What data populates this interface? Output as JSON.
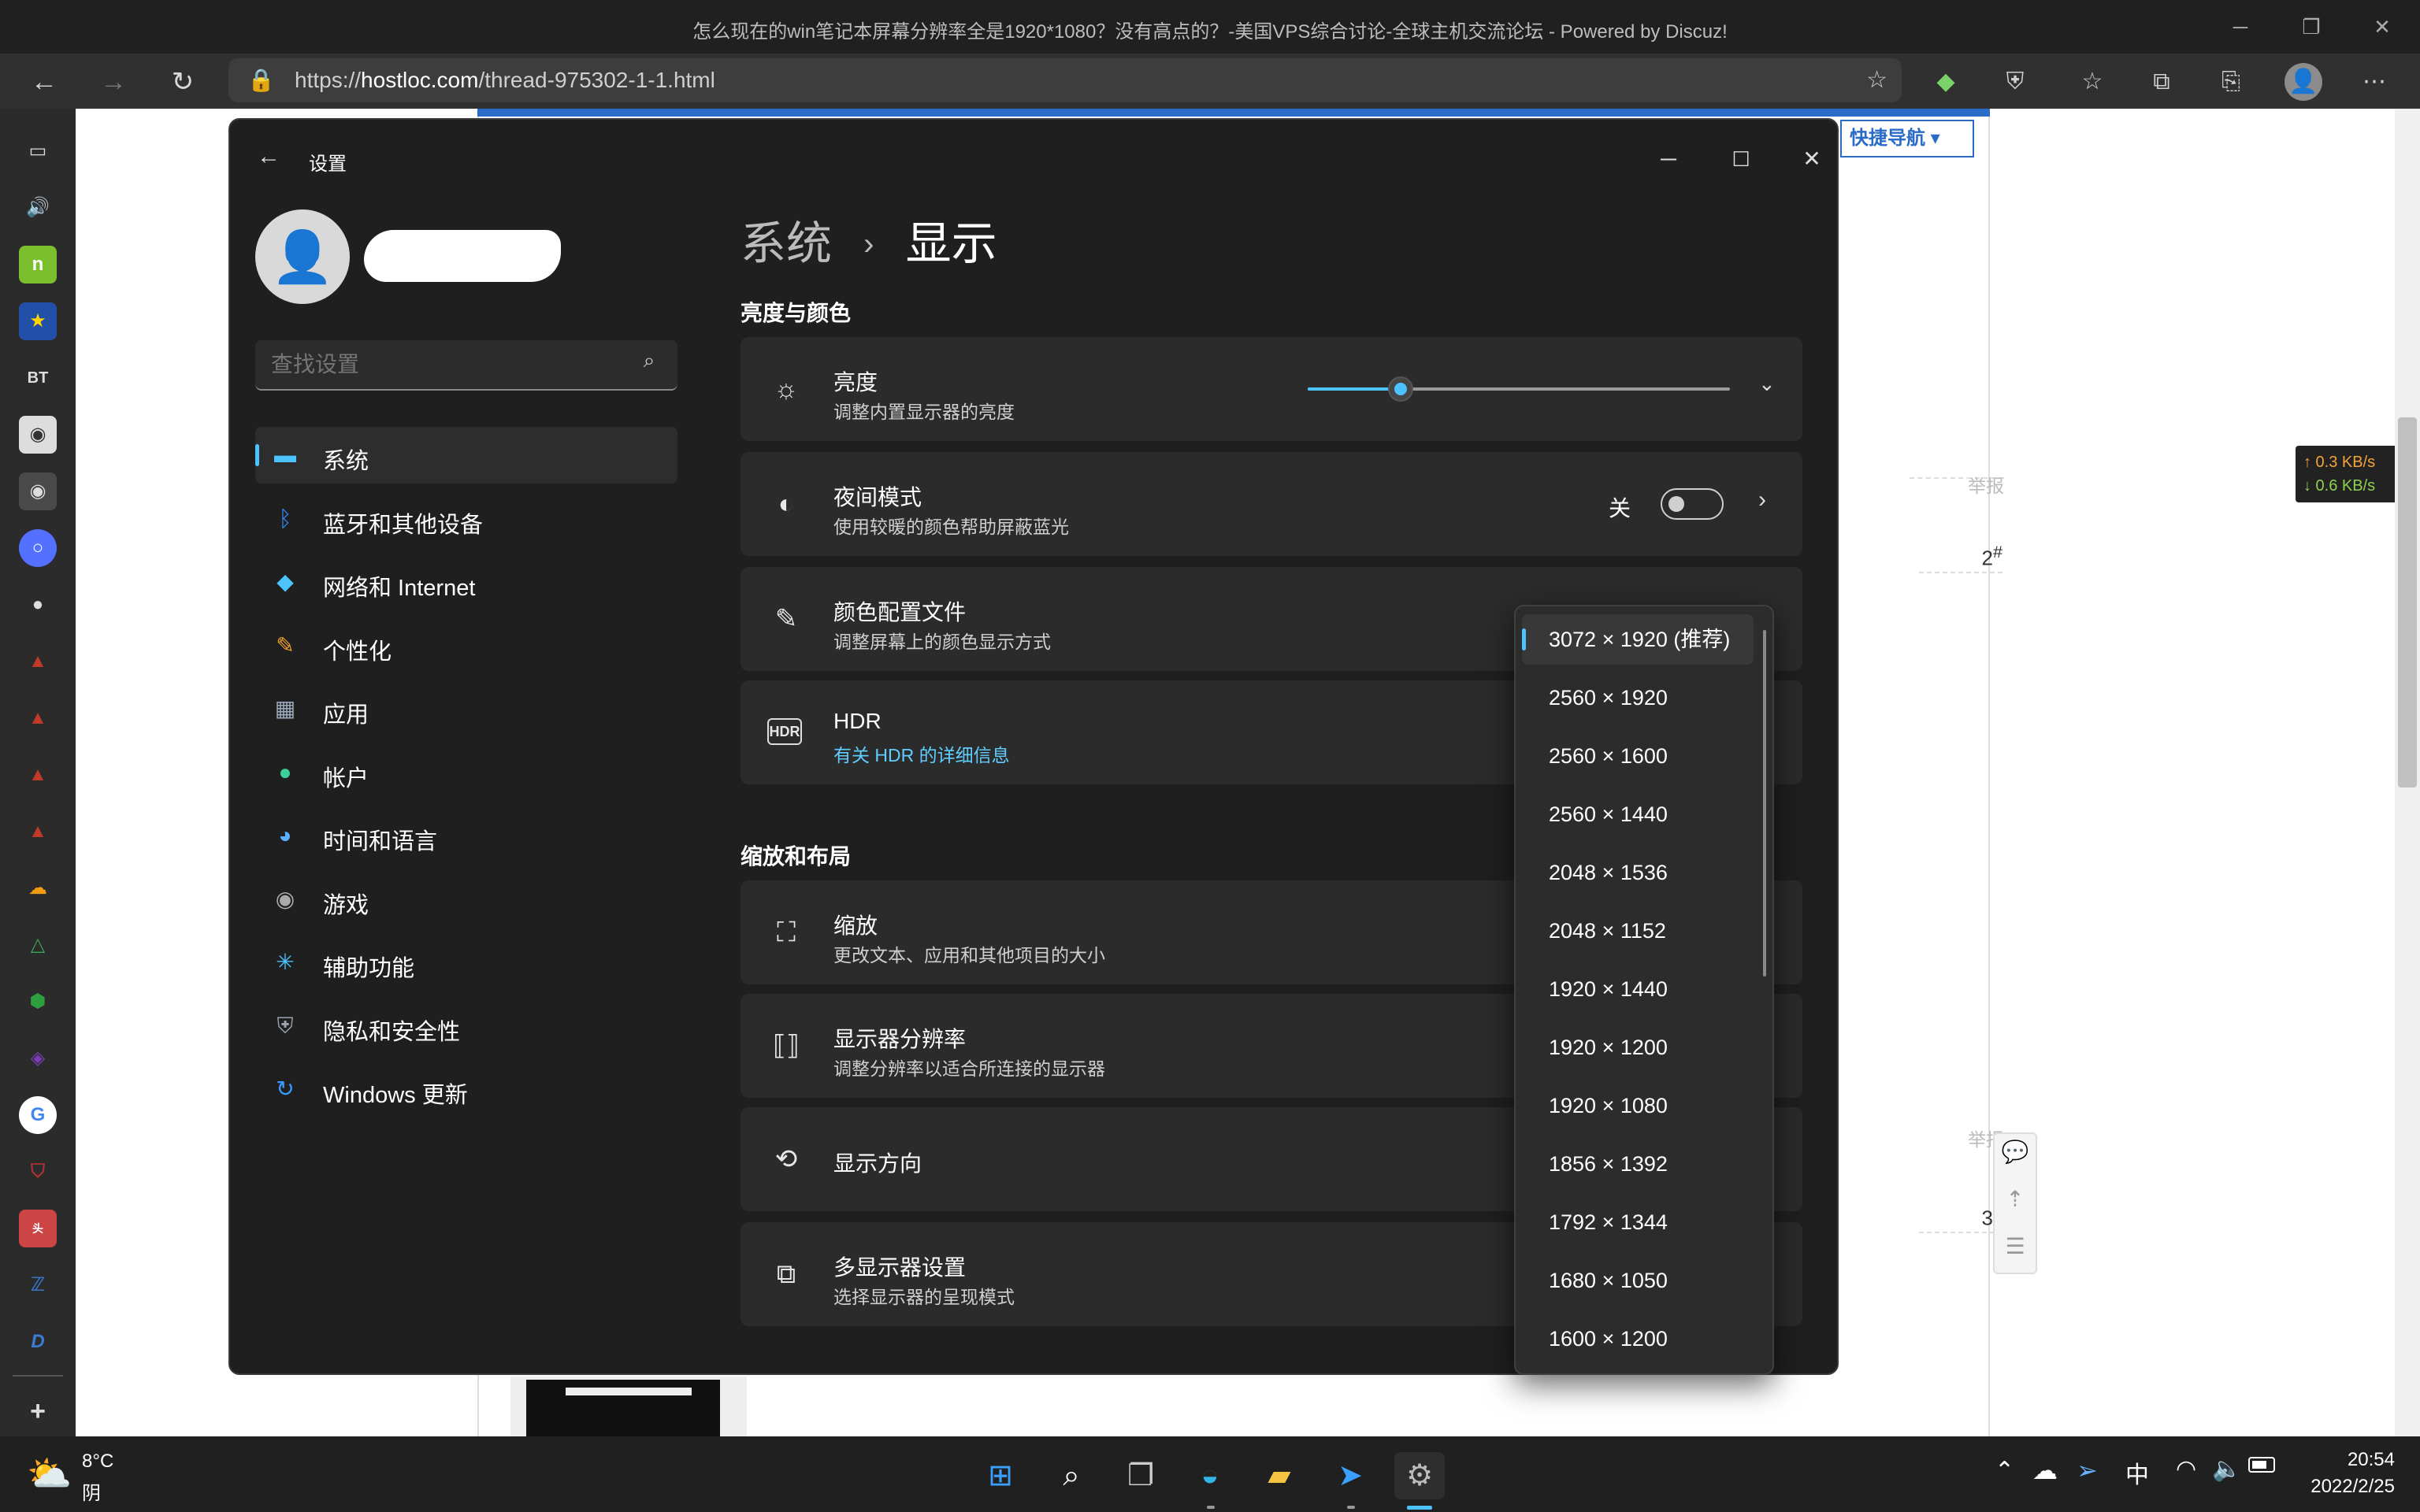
{
  "browser": {
    "window_title": "怎么现在的win笔记本屏幕分辨率全是1920*1080？没有高点的？-美国VPS综合讨论-全球主机交流论坛 - Powered by Discuz!",
    "url_prefix": "https://",
    "url_host": "hostloc.com",
    "url_path": "/thread-975302-1-1.html",
    "back_icon": "arrow-left-icon",
    "forward_icon": "arrow-right-icon",
    "refresh_icon": "refresh-icon"
  },
  "page": {
    "quick_nav": "快捷导航",
    "report_1": "举报",
    "floor_2": "2",
    "report_2": "举报",
    "floor_3": "3",
    "floor_suffix": "#",
    "net_up": "↑ 0.3 KB/s",
    "net_down": "↓ 0.6 KB/s"
  },
  "settings": {
    "app_title": "设置",
    "search_placeholder": "查找设置",
    "breadcrumb_parent": "系统",
    "breadcrumb_sep": "›",
    "breadcrumb_current": "显示",
    "nav": [
      {
        "label": "系统",
        "icon": "monitor-icon",
        "color": "#4cc2ff"
      },
      {
        "label": "蓝牙和其他设备",
        "icon": "bluetooth-icon",
        "color": "#2f8fff"
      },
      {
        "label": "网络和 Internet",
        "icon": "wifi-icon",
        "color": "#4cc2ff"
      },
      {
        "label": "个性化",
        "icon": "brush-icon",
        "color": "#f0a030"
      },
      {
        "label": "应用",
        "icon": "apps-icon",
        "color": "#9ab"
      },
      {
        "label": "帐户",
        "icon": "account-icon",
        "color": "#3ccf9a"
      },
      {
        "label": "时间和语言",
        "icon": "globe-clock-icon",
        "color": "#5bb0ff"
      },
      {
        "label": "游戏",
        "icon": "gamepad-icon",
        "color": "#aaa"
      },
      {
        "label": "辅助功能",
        "icon": "accessibility-icon",
        "color": "#4cc2ff"
      },
      {
        "label": "隐私和安全性",
        "icon": "shield-icon",
        "color": "#9aa3ad"
      },
      {
        "label": "Windows 更新",
        "icon": "update-icon",
        "color": "#3a9bff"
      }
    ],
    "section_brightness": "亮度与颜色",
    "brightness_title": "亮度",
    "brightness_sub": "调整内置显示器的亮度",
    "brightness_value": 0.22,
    "night_title": "夜间模式",
    "night_sub": "使用较暖的颜色帮助屏蔽蓝光",
    "night_state": "关",
    "color_profile_title": "颜色配置文件",
    "color_profile_sub": "调整屏幕上的颜色显示方式",
    "hdr_title": "HDR",
    "hdr_link": "有关 HDR 的详细信息",
    "section_scale": "缩放和布局",
    "scale_title": "缩放",
    "scale_sub": "更改文本、应用和其他项目的大小",
    "resolution_title": "显示器分辨率",
    "resolution_sub": "调整分辨率以适合所连接的显示器",
    "orientation_title": "显示方向",
    "multi_title": "多显示器设置",
    "multi_sub": "选择显示器的呈现模式",
    "accent": "#4cc2ff"
  },
  "dropdown": {
    "options": [
      "3072 × 1920 (推荐)",
      "2560 × 1920",
      "2560 × 1600",
      "2560 × 1440",
      "2048 × 1536",
      "2048 × 1152",
      "1920 × 1440",
      "1920 × 1200",
      "1920 × 1080",
      "1856 × 1392",
      "1792 × 1344",
      "1680 × 1050",
      "1600 × 1200"
    ]
  },
  "taskbar": {
    "temp": "8°C",
    "weather": "阴",
    "ime": "中",
    "time": "20:54",
    "date": "2022/2/25"
  }
}
